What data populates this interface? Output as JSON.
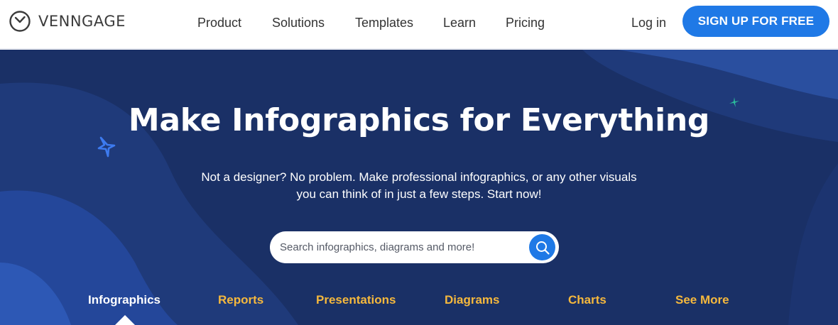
{
  "brand": {
    "name": "VENNGAGE"
  },
  "nav": {
    "items": [
      {
        "label": "Product"
      },
      {
        "label": "Solutions"
      },
      {
        "label": "Templates"
      },
      {
        "label": "Learn"
      },
      {
        "label": "Pricing"
      }
    ],
    "login_label": "Log in",
    "signup_label": "SIGN UP FOR FREE"
  },
  "hero": {
    "title": "Make Infographics for Everything",
    "subtitle_line1": "Not a designer? No problem. Make professional infographics, or any other visuals",
    "subtitle_line2": "you can think of in just a few steps. Start now!",
    "search": {
      "placeholder": "Search infographics, diagrams and more!",
      "value": ""
    }
  },
  "tabs": {
    "items": [
      {
        "label": "Infographics",
        "active": true
      },
      {
        "label": "Reports",
        "active": false
      },
      {
        "label": "Presentations",
        "active": false
      },
      {
        "label": "Diagrams",
        "active": false
      },
      {
        "label": "Charts",
        "active": false
      },
      {
        "label": "See More",
        "active": false
      }
    ]
  },
  "icons": {
    "logo": "venngage-clock-logo-icon",
    "search": "magnifier-icon",
    "sparkle_left": "sparkle-star-icon",
    "sparkle_right": "sparkle-star-icon"
  },
  "colors": {
    "accent": "#1f79e6",
    "hero_bg": "#1a3066",
    "tab_inactive": "#f5b83d",
    "tab_active": "#ffffff",
    "sparkle_left": "#3d7bf0",
    "sparkle_right": "#2bbd9c"
  }
}
